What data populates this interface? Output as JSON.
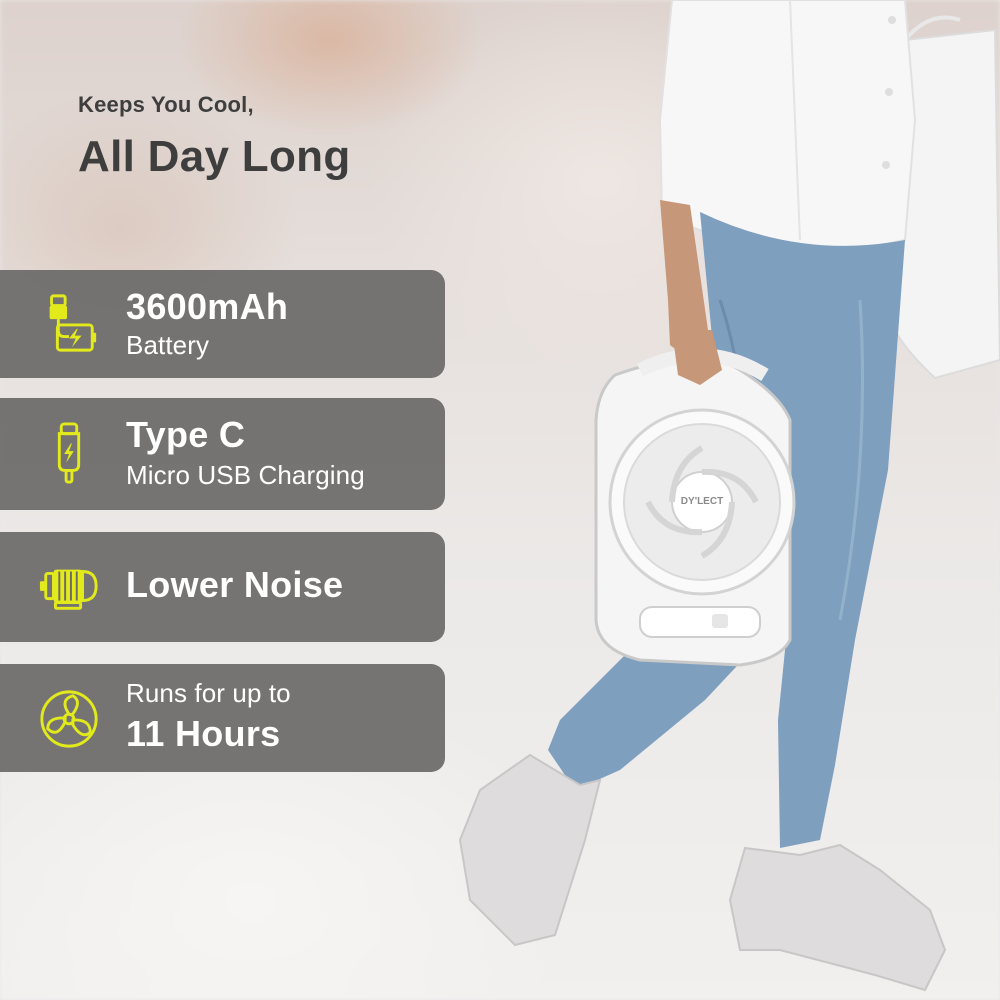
{
  "headline": {
    "line1": "Keeps You Cool,",
    "line2": "All Day Long"
  },
  "features": [
    {
      "title": "3600mAh",
      "subtitle": "Battery",
      "icon": "battery-charging-icon"
    },
    {
      "title": "Type C",
      "subtitle": "Micro USB Charging",
      "icon": "usb-c-plug-icon"
    },
    {
      "title": "Lower Noise",
      "icon": "motor-icon"
    },
    {
      "pre": "Runs for up to",
      "title": "11 Hours",
      "icon": "fan-icon"
    }
  ],
  "product": {
    "brand": "DY'LECT"
  },
  "colors": {
    "accent": "#e3ea1c",
    "card_bg": "#6c6a69",
    "headline_text": "#3e3e3e",
    "card_text": "#ffffff"
  }
}
